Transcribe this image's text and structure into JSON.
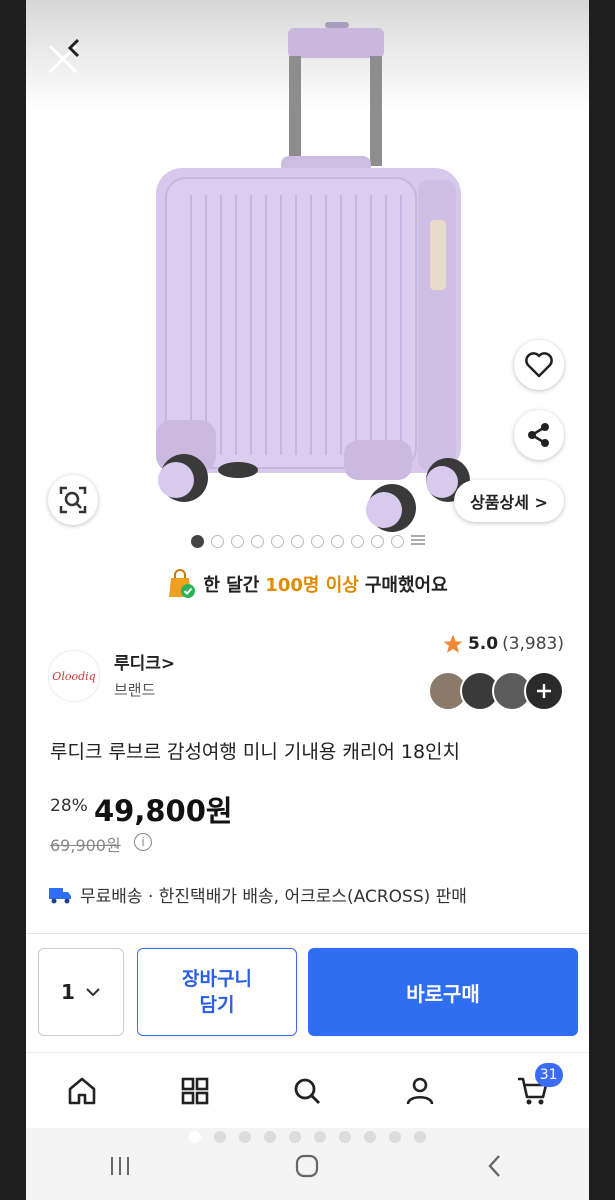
{
  "product": {
    "title": "루디크 루브르 감성여행 미니 기내용 캐리어 18인치",
    "discount": "28%",
    "price": "49,800원",
    "original_price": "69,900원",
    "image_count": 11,
    "active_image_index": 0
  },
  "hero": {
    "detail_label": "상품상세 >"
  },
  "promo": {
    "prefix": "한 달간 ",
    "highlight": "100명 이상",
    "suffix": " 구매했어요"
  },
  "brand": {
    "logo_text": "Oloodiq",
    "name": "루디크>",
    "sub": "브랜드"
  },
  "rating": {
    "score": "5.0",
    "count": "(3,983)"
  },
  "shipping": {
    "text": "무료배송 · 한진택배가 배송, 어크로스(ACROSS) 판매"
  },
  "actions": {
    "quantity": "1",
    "cart_label_line1": "장바구니",
    "cart_label_line2": "담기",
    "buy_label": "바로구매"
  },
  "nav": {
    "cart_badge": "31"
  },
  "colors": {
    "accent": "#2f6ef2",
    "promo_highlight": "#e08a00",
    "suitcase": "#d6c6ea"
  }
}
